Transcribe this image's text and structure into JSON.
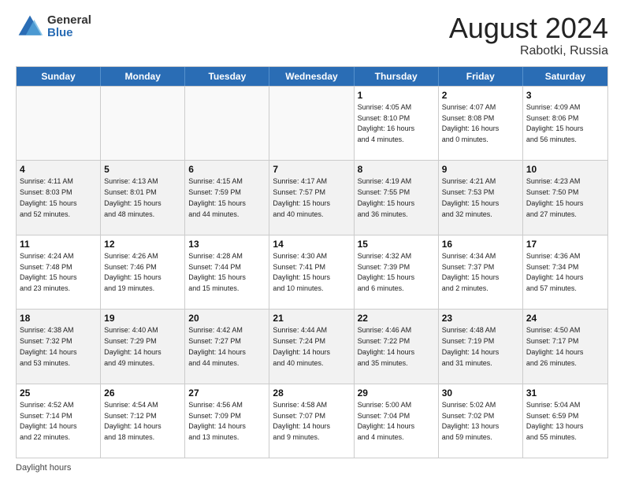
{
  "logo": {
    "general": "General",
    "blue": "Blue"
  },
  "title": "August 2024",
  "location": "Rabotki, Russia",
  "header_days": [
    "Sunday",
    "Monday",
    "Tuesday",
    "Wednesday",
    "Thursday",
    "Friday",
    "Saturday"
  ],
  "footer": "Daylight hours",
  "weeks": [
    [
      {
        "day": "",
        "content": ""
      },
      {
        "day": "",
        "content": ""
      },
      {
        "day": "",
        "content": ""
      },
      {
        "day": "",
        "content": ""
      },
      {
        "day": "1",
        "content": "Sunrise: 4:05 AM\nSunset: 8:10 PM\nDaylight: 16 hours\nand 4 minutes."
      },
      {
        "day": "2",
        "content": "Sunrise: 4:07 AM\nSunset: 8:08 PM\nDaylight: 16 hours\nand 0 minutes."
      },
      {
        "day": "3",
        "content": "Sunrise: 4:09 AM\nSunset: 8:06 PM\nDaylight: 15 hours\nand 56 minutes."
      }
    ],
    [
      {
        "day": "4",
        "content": "Sunrise: 4:11 AM\nSunset: 8:03 PM\nDaylight: 15 hours\nand 52 minutes."
      },
      {
        "day": "5",
        "content": "Sunrise: 4:13 AM\nSunset: 8:01 PM\nDaylight: 15 hours\nand 48 minutes."
      },
      {
        "day": "6",
        "content": "Sunrise: 4:15 AM\nSunset: 7:59 PM\nDaylight: 15 hours\nand 44 minutes."
      },
      {
        "day": "7",
        "content": "Sunrise: 4:17 AM\nSunset: 7:57 PM\nDaylight: 15 hours\nand 40 minutes."
      },
      {
        "day": "8",
        "content": "Sunrise: 4:19 AM\nSunset: 7:55 PM\nDaylight: 15 hours\nand 36 minutes."
      },
      {
        "day": "9",
        "content": "Sunrise: 4:21 AM\nSunset: 7:53 PM\nDaylight: 15 hours\nand 32 minutes."
      },
      {
        "day": "10",
        "content": "Sunrise: 4:23 AM\nSunset: 7:50 PM\nDaylight: 15 hours\nand 27 minutes."
      }
    ],
    [
      {
        "day": "11",
        "content": "Sunrise: 4:24 AM\nSunset: 7:48 PM\nDaylight: 15 hours\nand 23 minutes."
      },
      {
        "day": "12",
        "content": "Sunrise: 4:26 AM\nSunset: 7:46 PM\nDaylight: 15 hours\nand 19 minutes."
      },
      {
        "day": "13",
        "content": "Sunrise: 4:28 AM\nSunset: 7:44 PM\nDaylight: 15 hours\nand 15 minutes."
      },
      {
        "day": "14",
        "content": "Sunrise: 4:30 AM\nSunset: 7:41 PM\nDaylight: 15 hours\nand 10 minutes."
      },
      {
        "day": "15",
        "content": "Sunrise: 4:32 AM\nSunset: 7:39 PM\nDaylight: 15 hours\nand 6 minutes."
      },
      {
        "day": "16",
        "content": "Sunrise: 4:34 AM\nSunset: 7:37 PM\nDaylight: 15 hours\nand 2 minutes."
      },
      {
        "day": "17",
        "content": "Sunrise: 4:36 AM\nSunset: 7:34 PM\nDaylight: 14 hours\nand 57 minutes."
      }
    ],
    [
      {
        "day": "18",
        "content": "Sunrise: 4:38 AM\nSunset: 7:32 PM\nDaylight: 14 hours\nand 53 minutes."
      },
      {
        "day": "19",
        "content": "Sunrise: 4:40 AM\nSunset: 7:29 PM\nDaylight: 14 hours\nand 49 minutes."
      },
      {
        "day": "20",
        "content": "Sunrise: 4:42 AM\nSunset: 7:27 PM\nDaylight: 14 hours\nand 44 minutes."
      },
      {
        "day": "21",
        "content": "Sunrise: 4:44 AM\nSunset: 7:24 PM\nDaylight: 14 hours\nand 40 minutes."
      },
      {
        "day": "22",
        "content": "Sunrise: 4:46 AM\nSunset: 7:22 PM\nDaylight: 14 hours\nand 35 minutes."
      },
      {
        "day": "23",
        "content": "Sunrise: 4:48 AM\nSunset: 7:19 PM\nDaylight: 14 hours\nand 31 minutes."
      },
      {
        "day": "24",
        "content": "Sunrise: 4:50 AM\nSunset: 7:17 PM\nDaylight: 14 hours\nand 26 minutes."
      }
    ],
    [
      {
        "day": "25",
        "content": "Sunrise: 4:52 AM\nSunset: 7:14 PM\nDaylight: 14 hours\nand 22 minutes."
      },
      {
        "day": "26",
        "content": "Sunrise: 4:54 AM\nSunset: 7:12 PM\nDaylight: 14 hours\nand 18 minutes."
      },
      {
        "day": "27",
        "content": "Sunrise: 4:56 AM\nSunset: 7:09 PM\nDaylight: 14 hours\nand 13 minutes."
      },
      {
        "day": "28",
        "content": "Sunrise: 4:58 AM\nSunset: 7:07 PM\nDaylight: 14 hours\nand 9 minutes."
      },
      {
        "day": "29",
        "content": "Sunrise: 5:00 AM\nSunset: 7:04 PM\nDaylight: 14 hours\nand 4 minutes."
      },
      {
        "day": "30",
        "content": "Sunrise: 5:02 AM\nSunset: 7:02 PM\nDaylight: 13 hours\nand 59 minutes."
      },
      {
        "day": "31",
        "content": "Sunrise: 5:04 AM\nSunset: 6:59 PM\nDaylight: 13 hours\nand 55 minutes."
      }
    ]
  ]
}
